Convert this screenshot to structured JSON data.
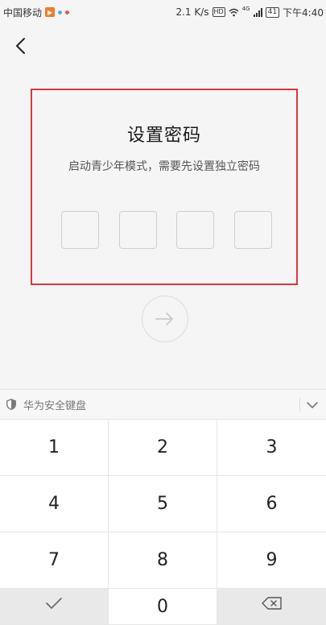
{
  "status_bar": {
    "carrier": "中国移动",
    "speed": "2.1 K/s",
    "hd": "HD",
    "network": "4G",
    "battery": "41",
    "time": "下午4:40"
  },
  "nav": {
    "back_icon": "chevron-left-icon"
  },
  "page": {
    "title": "设置密码",
    "subtitle": "启动青少年模式，需要先设置独立密码",
    "pin_count": 4
  },
  "next_button": {
    "icon": "arrow-right-icon"
  },
  "keyboard": {
    "label": "华为安全键盘",
    "keys": [
      "1",
      "2",
      "3",
      "4",
      "5",
      "6",
      "7",
      "8",
      "9",
      "0"
    ],
    "confirm_icon": "check-icon",
    "delete_icon": "backspace-icon",
    "collapse_icon": "chevron-down-icon",
    "shield_icon": "shield-icon"
  },
  "colors": {
    "highlight_border": "#d9363e",
    "background": "#f5f5f5",
    "pin_border": "#cfcfcf"
  }
}
